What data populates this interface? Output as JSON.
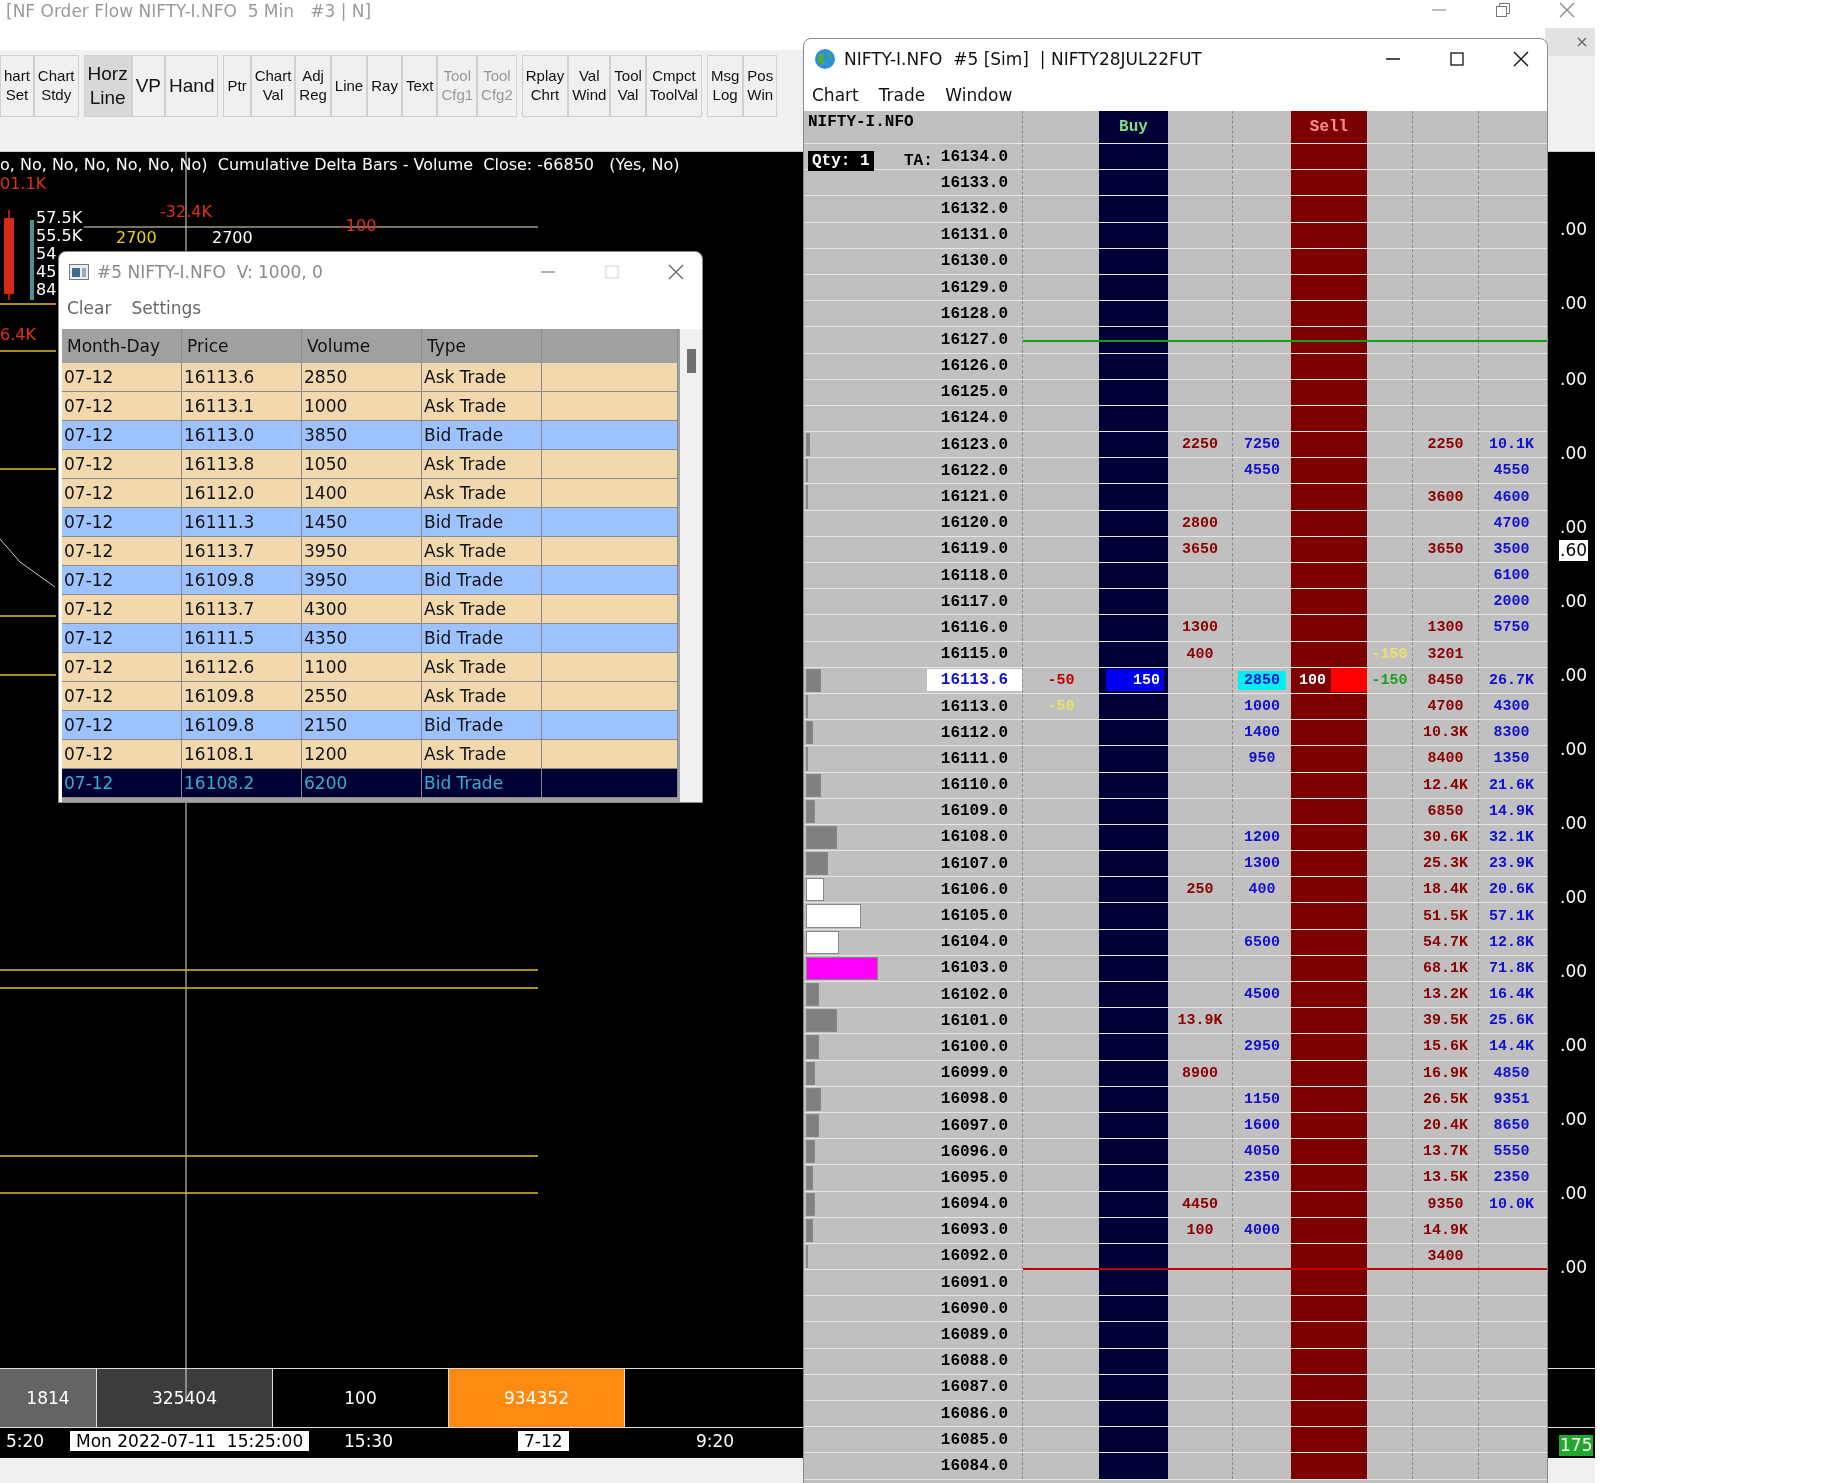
{
  "main_window": {
    "title": "[NF Order Flow NIFTY-I.NFO  5 Min   #3 | N]"
  },
  "toolbar": {
    "groups": [
      [
        {
          "lines": [
            "hart",
            "Set"
          ],
          "kind": "small",
          "selected": false,
          "disabled": false
        },
        {
          "lines": [
            "Chart",
            "Stdy"
          ],
          "kind": "small",
          "selected": false,
          "disabled": false
        }
      ],
      [
        {
          "lines": [
            "Horz",
            "Line"
          ],
          "kind": "large",
          "selected": true,
          "disabled": false
        },
        {
          "lines": [
            "VP"
          ],
          "kind": "large",
          "selected": false,
          "disabled": false
        },
        {
          "lines": [
            "Hand"
          ],
          "kind": "large",
          "selected": false,
          "disabled": false
        }
      ],
      [
        {
          "lines": [
            "Ptr"
          ],
          "kind": "small",
          "selected": false,
          "disabled": false
        },
        {
          "lines": [
            "Chart",
            "Val"
          ],
          "kind": "small",
          "selected": false,
          "disabled": false
        },
        {
          "lines": [
            "Adj",
            "Reg"
          ],
          "kind": "small",
          "selected": false,
          "disabled": false
        },
        {
          "lines": [
            "Line"
          ],
          "kind": "small",
          "selected": false,
          "disabled": false
        },
        {
          "lines": [
            "Ray"
          ],
          "kind": "small",
          "selected": false,
          "disabled": false
        },
        {
          "lines": [
            "Text"
          ],
          "kind": "small",
          "selected": false,
          "disabled": false
        },
        {
          "lines": [
            "Tool",
            "Cfg1"
          ],
          "kind": "small",
          "selected": false,
          "disabled": true
        },
        {
          "lines": [
            "Tool",
            "Cfg2"
          ],
          "kind": "small",
          "selected": false,
          "disabled": true
        }
      ],
      [
        {
          "lines": [
            "Rplay",
            "Chrt"
          ],
          "kind": "small",
          "selected": false,
          "disabled": false
        },
        {
          "lines": [
            "Val",
            "Wind"
          ],
          "kind": "small",
          "selected": false,
          "disabled": false
        },
        {
          "lines": [
            "Tool",
            "Val"
          ],
          "kind": "small",
          "selected": false,
          "disabled": false
        },
        {
          "lines": [
            "Cmpct",
            "ToolVal"
          ],
          "kind": "small",
          "selected": false,
          "disabled": false
        }
      ],
      [
        {
          "lines": [
            "Msg",
            "Log"
          ],
          "kind": "small",
          "selected": false,
          "disabled": false
        },
        {
          "lines": [
            "Pos",
            "Win"
          ],
          "kind": "small",
          "selected": false,
          "disabled": false
        }
      ]
    ]
  },
  "chart": {
    "header": "o, No, No, No, No, No, No)  Cumulative Delta Bars - Volume  Close: -66850   (Yes, No)",
    "labels": [
      {
        "text": "01.1K",
        "color": "#e0301e"
      },
      {
        "text": "-32.4K",
        "color": "#e0301e"
      },
      {
        "text": "-100",
        "color": "#e0301e"
      },
      {
        "text": "57.5K",
        "color": "#ffffff"
      },
      {
        "text": "55.5K",
        "color": "#ffffff"
      },
      {
        "text": "2700",
        "color": "#e8d020"
      },
      {
        "text": "2700",
        "color": "#ffffff"
      },
      {
        "text": "54",
        "color": "#ffffff"
      },
      {
        "text": "45",
        "color": "#ffffff"
      },
      {
        "text": "84",
        "color": "#ffffff"
      },
      {
        "text": "6.4K",
        "color": "#e0301e"
      }
    ],
    "price_axis": [
      {
        "text": ".00",
        "kind": "plain"
      },
      {
        "text": ".00",
        "kind": "plain"
      },
      {
        "text": ".00",
        "kind": "plain"
      },
      {
        "text": ".00",
        "kind": "plain"
      },
      {
        "text": ".00",
        "kind": "plain"
      },
      {
        "text": ".60",
        "kind": "boxed"
      },
      {
        "text": ".00",
        "kind": "plain"
      },
      {
        "text": ".00",
        "kind": "plain"
      },
      {
        "text": ".00",
        "kind": "plain"
      },
      {
        "text": ".00",
        "kind": "plain"
      },
      {
        "text": ".00",
        "kind": "plain"
      },
      {
        "text": ".00",
        "kind": "plain"
      },
      {
        "text": ".00",
        "kind": "plain"
      },
      {
        "text": ".00",
        "kind": "plain"
      },
      {
        "text": ".00",
        "kind": "plain"
      },
      {
        "text": ".00",
        "kind": "plain"
      },
      {
        "text": "175",
        "kind": "last"
      }
    ],
    "summary": [
      {
        "text": "1814",
        "color": "#646464"
      },
      {
        "text": "325404",
        "color": "#3c3c3c"
      },
      {
        "text": "100",
        "color": "#000000"
      },
      {
        "text": "934352",
        "color": "#ff8a12"
      }
    ],
    "time_axis": [
      {
        "text": "5:20",
        "boxed": false
      },
      {
        "text": "Mon 2022-07-11  15:25:00",
        "boxed": true
      },
      {
        "text": "15:30",
        "boxed": false
      },
      {
        "text": "7-12",
        "boxed": true
      },
      {
        "text": "9:20",
        "boxed": false
      }
    ]
  },
  "trade_window": {
    "title": "#5 NIFTY-I.NFO  V: 1000, 0",
    "menu": [
      "Clear",
      "Settings"
    ],
    "columns": [
      "Month-Day",
      "Price",
      "Volume",
      "Type"
    ],
    "rows": [
      {
        "cells": [
          "07-12",
          "16113.6",
          "2850",
          "Ask Trade"
        ],
        "kind": "ask",
        "selected": false
      },
      {
        "cells": [
          "07-12",
          "16113.1",
          "1000",
          "Ask Trade"
        ],
        "kind": "ask",
        "selected": false
      },
      {
        "cells": [
          "07-12",
          "16113.0",
          "3850",
          "Bid Trade"
        ],
        "kind": "bid",
        "selected": false
      },
      {
        "cells": [
          "07-12",
          "16113.8",
          "1050",
          "Ask Trade"
        ],
        "kind": "ask",
        "selected": false
      },
      {
        "cells": [
          "07-12",
          "16112.0",
          "1400",
          "Ask Trade"
        ],
        "kind": "ask",
        "selected": false
      },
      {
        "cells": [
          "07-12",
          "16111.3",
          "1450",
          "Bid Trade"
        ],
        "kind": "bid",
        "selected": false
      },
      {
        "cells": [
          "07-12",
          "16113.7",
          "3950",
          "Ask Trade"
        ],
        "kind": "ask",
        "selected": false
      },
      {
        "cells": [
          "07-12",
          "16109.8",
          "3950",
          "Bid Trade"
        ],
        "kind": "bid",
        "selected": false
      },
      {
        "cells": [
          "07-12",
          "16113.7",
          "4300",
          "Ask Trade"
        ],
        "kind": "ask",
        "selected": false
      },
      {
        "cells": [
          "07-12",
          "16111.5",
          "4350",
          "Bid Trade"
        ],
        "kind": "bid",
        "selected": false
      },
      {
        "cells": [
          "07-12",
          "16112.6",
          "1100",
          "Ask Trade"
        ],
        "kind": "ask",
        "selected": false
      },
      {
        "cells": [
          "07-12",
          "16109.8",
          "2550",
          "Ask Trade"
        ],
        "kind": "ask",
        "selected": false
      },
      {
        "cells": [
          "07-12",
          "16109.8",
          "2150",
          "Bid Trade"
        ],
        "kind": "bid",
        "selected": false
      },
      {
        "cells": [
          "07-12",
          "16108.1",
          "1200",
          "Ask Trade"
        ],
        "kind": "ask",
        "selected": false
      },
      {
        "cells": [
          "07-12",
          "16108.2",
          "6200",
          "Bid Trade"
        ],
        "kind": "bid",
        "selected": true
      }
    ]
  },
  "dom_window": {
    "title": "NIFTY-I.NFO  #5 [Sim]  | NIFTY28JUL22FUT",
    "menu": [
      "Chart",
      "Trade",
      "Window"
    ],
    "header": {
      "symbol": "NIFTY-I.NFO",
      "qty": "Qty: 1",
      "ta": "TA:",
      "buy": "Buy",
      "sell": "Sell"
    },
    "rows": [
      {
        "price": "16134.0",
        "current": false
      },
      {
        "price": "16133.0",
        "current": false
      },
      {
        "price": "16132.0",
        "current": false
      },
      {
        "price": "16131.0",
        "current": false
      },
      {
        "price": "16130.0",
        "current": false
      },
      {
        "price": "16129.0",
        "current": false
      },
      {
        "price": "16128.0",
        "current": false
      },
      {
        "price": "16127.0",
        "current": false,
        "session_high": true
      },
      {
        "price": "16126.0",
        "current": false
      },
      {
        "price": "16125.0",
        "current": false
      },
      {
        "price": "16124.0",
        "current": false
      },
      {
        "price": "16123.0",
        "current": false,
        "volume_bar": {
          "level": 0.02,
          "color": "#808080"
        },
        "column_4": "2250",
        "column_5": "7250",
        "column_8": "2250",
        "column_9": "10.1K"
      },
      {
        "price": "16122.0",
        "current": false,
        "volume_bar": {
          "level": 0.01,
          "color": "#808080"
        },
        "column_5": "4550",
        "column_9": "4550"
      },
      {
        "price": "16121.0",
        "current": false,
        "volume_bar": {
          "level": 0.01,
          "color": "#808080"
        },
        "column_8": "3600",
        "column_9": "4600"
      },
      {
        "price": "16120.0",
        "current": false,
        "column_4": "2800",
        "column_9": "4700"
      },
      {
        "price": "16119.0",
        "current": false,
        "column_4": "3650",
        "column_8": "3650",
        "column_9": "3500"
      },
      {
        "price": "16118.0",
        "current": false,
        "column_9": "6100"
      },
      {
        "price": "16117.0",
        "current": false,
        "column_9": "2000"
      },
      {
        "price": "16116.0",
        "current": false,
        "column_4": "1300",
        "column_8": "1300",
        "column_9": "5750"
      },
      {
        "price": "16115.0",
        "current": false,
        "column_4": "400",
        "column_7": {
          "text": "-150",
          "color": "#e8e070"
        },
        "column_8": "3201"
      },
      {
        "price": "16113.6",
        "current": true,
        "volume_bar": {
          "level": 0.07,
          "color": "#808080"
        },
        "column_2": {
          "text": "-50",
          "color": "#c00000"
        },
        "buy": "150",
        "column_5": "2850",
        "sell": "100",
        "column_7": {
          "text": "-150",
          "color": "#20a020"
        },
        "column_8": "8450",
        "column_9": "26.7K"
      },
      {
        "price": "16113.0",
        "current": false,
        "volume_bar": {
          "level": 0.01,
          "color": "#808080"
        },
        "column_2": {
          "text": "-50",
          "color": "#e8e070"
        },
        "column_5": "1000",
        "column_8": "4700",
        "column_9": "4300"
      },
      {
        "price": "16112.0",
        "current": false,
        "volume_bar": {
          "level": 0.03,
          "color": "#808080"
        },
        "column_5": "1400",
        "column_8": "10.3K",
        "column_9": "8300"
      },
      {
        "price": "16111.0",
        "current": false,
        "volume_bar": {
          "level": 0.01,
          "color": "#808080"
        },
        "column_5": "950",
        "column_8": "8400",
        "column_9": "1350"
      },
      {
        "price": "16110.0",
        "current": false,
        "volume_bar": {
          "level": 0.07,
          "color": "#808080"
        },
        "column_8": "12.4K",
        "column_9": "21.6K"
      },
      {
        "price": "16109.0",
        "current": false,
        "volume_bar": {
          "level": 0.04,
          "color": "#808080"
        },
        "column_8": "6850",
        "column_9": "14.9K"
      },
      {
        "price": "16108.0",
        "current": false,
        "volume_bar": {
          "level": 0.14,
          "color": "#808080"
        },
        "column_5": "1200",
        "column_8": "30.6K",
        "column_9": "32.1K"
      },
      {
        "price": "16107.0",
        "current": false,
        "volume_bar": {
          "level": 0.1,
          "color": "#808080"
        },
        "column_5": "1300",
        "column_8": "25.3K",
        "column_9": "23.9K"
      },
      {
        "price": "16106.0",
        "current": false,
        "volume_bar": {
          "level": 0.08,
          "color": "#ffffff"
        },
        "column_4": "250",
        "column_5": "400",
        "column_8": "18.4K",
        "column_9": "20.6K"
      },
      {
        "price": "16105.0",
        "current": false,
        "volume_bar": {
          "level": 0.25,
          "color": "#ffffff"
        },
        "column_8": "51.5K",
        "column_9": "57.1K"
      },
      {
        "price": "16104.0",
        "current": false,
        "volume_bar": {
          "level": 0.15,
          "color": "#ffffff"
        },
        "column_5": "6500",
        "column_8": "54.7K",
        "column_9": "12.8K"
      },
      {
        "price": "16103.0",
        "current": false,
        "volume_bar": {
          "level": 0.33,
          "color": "#ff00ff"
        },
        "column_8": "68.1K",
        "column_9": "71.8K"
      },
      {
        "price": "16102.0",
        "current": false,
        "volume_bar": {
          "level": 0.06,
          "color": "#808080"
        },
        "column_5": "4500",
        "column_8": "13.2K",
        "column_9": "16.4K"
      },
      {
        "price": "16101.0",
        "current": false,
        "volume_bar": {
          "level": 0.14,
          "color": "#808080"
        },
        "column_4": "13.9K",
        "column_8": "39.5K",
        "column_9": "25.6K"
      },
      {
        "price": "16100.0",
        "current": false,
        "volume_bar": {
          "level": 0.06,
          "color": "#808080"
        },
        "column_5": "2950",
        "column_8": "15.6K",
        "column_9": "14.4K"
      },
      {
        "price": "16099.0",
        "current": false,
        "volume_bar": {
          "level": 0.04,
          "color": "#808080"
        },
        "column_4": "8900",
        "column_8": "16.9K",
        "column_9": "4850"
      },
      {
        "price": "16098.0",
        "current": false,
        "volume_bar": {
          "level": 0.07,
          "color": "#808080"
        },
        "column_5": "1150",
        "column_8": "26.5K",
        "column_9": "9351"
      },
      {
        "price": "16097.0",
        "current": false,
        "volume_bar": {
          "level": 0.06,
          "color": "#808080"
        },
        "column_5": "1600",
        "column_8": "20.4K",
        "column_9": "8650"
      },
      {
        "price": "16096.0",
        "current": false,
        "volume_bar": {
          "level": 0.04,
          "color": "#808080"
        },
        "column_5": "4050",
        "column_8": "13.7K",
        "column_9": "5550"
      },
      {
        "price": "16095.0",
        "current": false,
        "volume_bar": {
          "level": 0.03,
          "color": "#808080"
        },
        "column_5": "2350",
        "column_8": "13.5K",
        "column_9": "2350"
      },
      {
        "price": "16094.0",
        "current": false,
        "volume_bar": {
          "level": 0.04,
          "color": "#808080"
        },
        "column_4": "4450",
        "column_8": "9350",
        "column_9": "10.0K"
      },
      {
        "price": "16093.0",
        "current": false,
        "volume_bar": {
          "level": 0.03,
          "color": "#808080"
        },
        "column_4": "100",
        "column_5": "4000",
        "column_8": "14.9K"
      },
      {
        "price": "16092.0",
        "current": false,
        "volume_bar": {
          "level": 0.01,
          "color": "#808080"
        },
        "column_8": "3400",
        "session_low": true
      },
      {
        "price": "16091.0",
        "current": false
      },
      {
        "price": "16090.0",
        "current": false
      },
      {
        "price": "16089.0",
        "current": false
      },
      {
        "price": "16088.0",
        "current": false
      },
      {
        "price": "16087.0",
        "current": false
      },
      {
        "price": "16086.0",
        "current": false
      },
      {
        "price": "16085.0",
        "current": false
      },
      {
        "price": "16084.0",
        "current": false
      }
    ]
  }
}
